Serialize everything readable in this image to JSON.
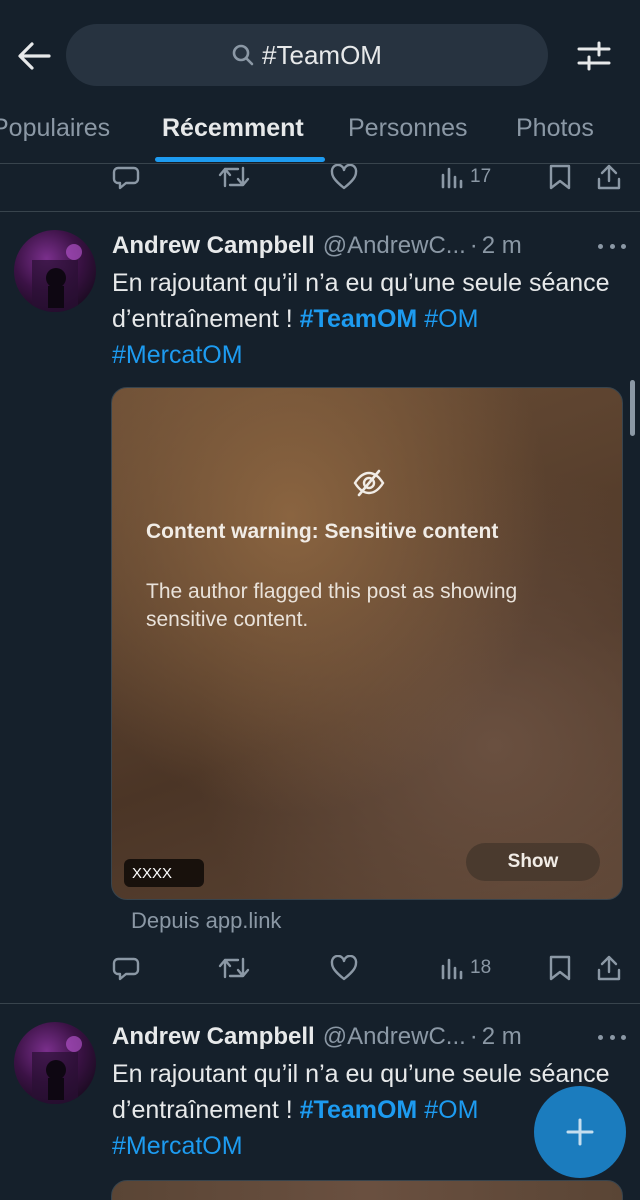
{
  "header": {
    "search_query": "#TeamOM"
  },
  "tabs": [
    {
      "label": "Populaires",
      "active": false
    },
    {
      "label": "Récemment",
      "active": true
    },
    {
      "label": "Personnes",
      "active": false
    },
    {
      "label": "Photos",
      "active": false
    }
  ],
  "top_actions": {
    "views_count": "17"
  },
  "tweets": [
    {
      "author_name": "Andrew Campbell",
      "author_handle": "@AndrewC...",
      "separator": "·",
      "time": "2 m",
      "text_prefix": "En rajoutant qu’il n’a eu qu’une seule séance d’entraînement ! ",
      "hashtags": [
        "#TeamOM",
        "#OM",
        "#MercatOM"
      ],
      "media": {
        "warning_title": "Content warning: Sensitive content",
        "warning_body": "The author flagged this post as showing sensitive content.",
        "show_label": "Show",
        "badge_text": "XXXX"
      },
      "source": "Depuis app.link",
      "views_count": "18"
    },
    {
      "author_name": "Andrew Campbell",
      "author_handle": "@AndrewC...",
      "separator": "·",
      "time": "2 m",
      "text_prefix": "En rajoutant qu’il n’a eu qu’une seule séance d’entraînement ! ",
      "hashtags": [
        "#TeamOM",
        "#OM",
        "#MercatOM"
      ]
    }
  ],
  "colors": {
    "background": "#15202b",
    "accent": "#1d9bf0",
    "secondary_text": "#8b98a5",
    "divider": "#38444d"
  },
  "icons": [
    "back-arrow-icon",
    "search-icon",
    "filter-icon",
    "reply-icon",
    "retweet-icon",
    "like-icon",
    "views-icon",
    "bookmark-icon",
    "share-icon",
    "more-icon",
    "eye-slash-icon",
    "compose-plus-icon"
  ]
}
